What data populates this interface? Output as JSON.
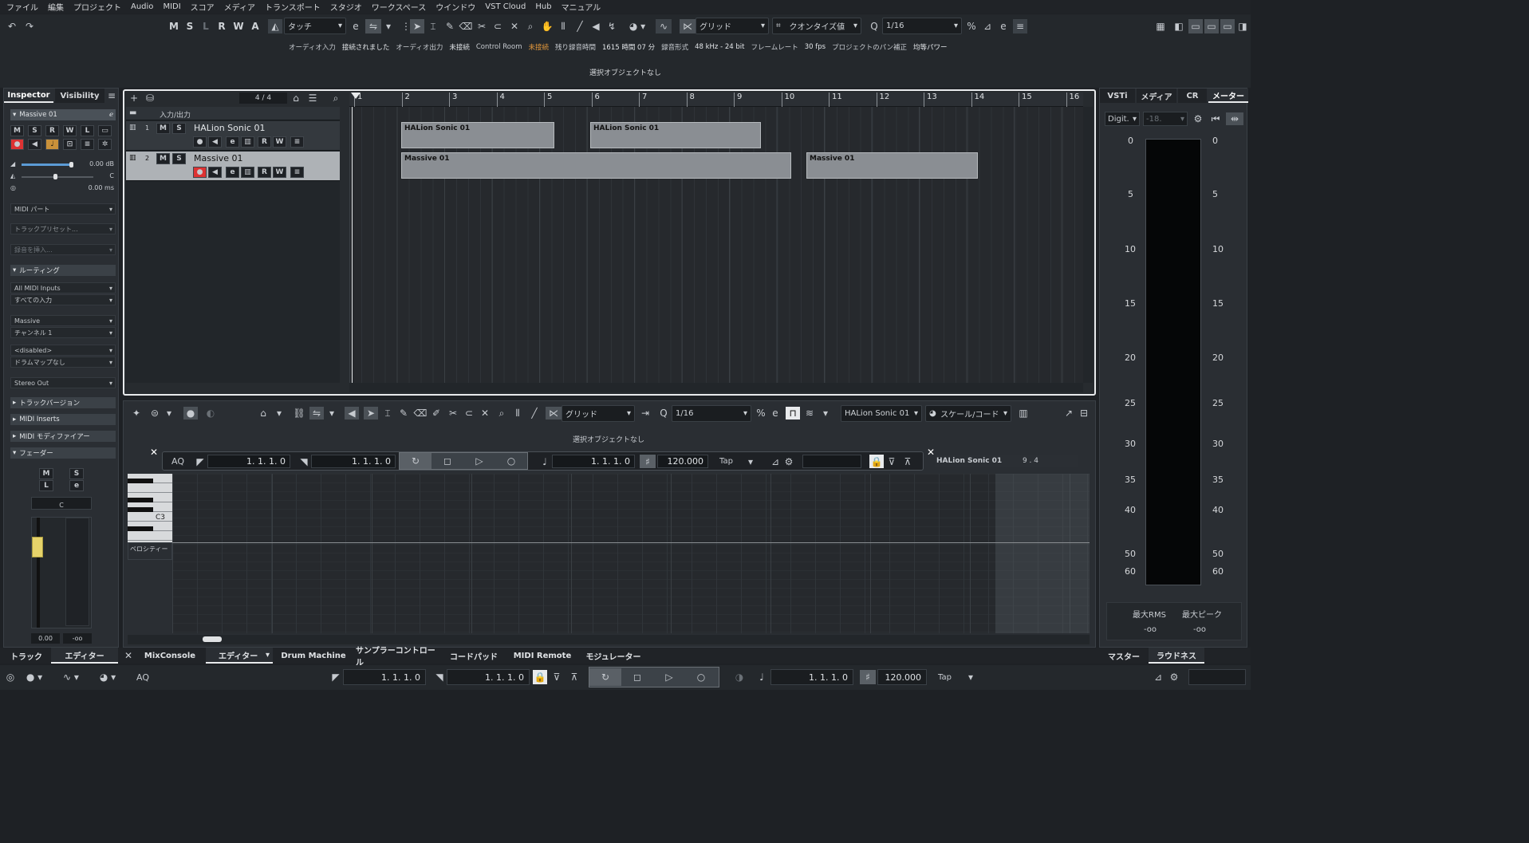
{
  "menu": [
    "ファイル",
    "編集",
    "プロジェクト",
    "Audio",
    "MIDI",
    "スコア",
    "メディア",
    "トランスポート",
    "スタジオ",
    "ワークスペース",
    "ウインドウ",
    "VST Cloud",
    "Hub",
    "マニュアル"
  ],
  "toolbar": {
    "m": "M",
    "s": "S",
    "l": "L",
    "r": "R",
    "w": "W",
    "a": "A",
    "automation_mode": "タッチ",
    "snap": "グリッド",
    "quantize_type": "クオンタイズ値",
    "quantize_value": "1/16"
  },
  "status": {
    "audio_in_label": "オーディオ入力",
    "audio_in": "接続されました",
    "audio_out_label": "オーディオ出力",
    "audio_out": "未接続",
    "cr_label": "Control Room",
    "cr": "未接続",
    "rec_time_label": "残り録音時間",
    "rec_time": "1615 時間 07 分",
    "rec_format_label": "録音形式",
    "rec_format": "48 kHz - 24 bit",
    "framerate_label": "フレームレート",
    "framerate": "30 fps",
    "pan_label": "プロジェクトのパン補正",
    "pan": "均等パワー"
  },
  "info_line": "選択オブジェクトなし",
  "inspector": {
    "tab_inspector": "Inspector",
    "tab_visibility": "Visibility",
    "track_name": "Massive 01",
    "volume": "0.00 dB",
    "pan": "C",
    "delay": "0.00 ms",
    "midi_part": "MIDI パート",
    "track_preset": "トラックプリセット...",
    "insert_audio": "録音を挿入...",
    "routing": "ルーティング",
    "midi_in": "All MIDI Inputs",
    "all_in": "すべての入力",
    "instrument": "Massive",
    "channel": "チャンネル 1",
    "disabled": "<disabled>",
    "drum_map": "ドラムマップなし",
    "out": "Stereo Out",
    "sec_version": "トラックバージョン",
    "sec_inserts": "MIDI Inserts",
    "sec_modifiers": "MIDI モディファイアー",
    "sec_fader": "フェーダー",
    "fader_m": "M",
    "fader_s": "S",
    "fader_l": "L",
    "fader_e": "e",
    "fader_pan": "C",
    "fader_val": "0.00",
    "fader_peak": "-oo"
  },
  "arranger": {
    "signature": "4 / 4",
    "io_label": "入力/出力",
    "ruler": [
      "1",
      "2",
      "3",
      "4",
      "5",
      "6",
      "7",
      "8",
      "9",
      "10",
      "11",
      "12",
      "13",
      "14",
      "15",
      "16"
    ],
    "tracks": [
      {
        "num": "1",
        "name": "HALion Sonic 01"
      },
      {
        "num": "2",
        "name": "Massive 01"
      }
    ],
    "parts": [
      {
        "label": "HALion Sonic 01"
      },
      {
        "label": "HALion Sonic 01"
      },
      {
        "label": "Massive 01"
      },
      {
        "label": "Massive 01"
      }
    ]
  },
  "editor": {
    "snap": "グリッド",
    "quantize": "1/16",
    "instrument": "HALion Sonic 01",
    "scale": "スケール/コード",
    "info_line": "選択オブジェクトなし",
    "note_label": "C3",
    "lane_label": "ベロシティー",
    "ruler_part": "HALion Sonic 01",
    "ruler_pos": "9 . 4",
    "aq": "AQ",
    "left_loc": "1. 1. 1.   0",
    "right_loc": "1. 1. 1.   0",
    "pos": "1. 1. 1.   0",
    "tempo": "120.000",
    "tap": "Tap"
  },
  "right": {
    "tabs": [
      "VSTi",
      "メディア",
      "CR",
      "メーター"
    ],
    "digit": "Digit.",
    "digit_val": "-18.",
    "scale": [
      "0",
      "5",
      "10",
      "15",
      "20",
      "25",
      "30",
      "35",
      "40",
      "50",
      "60"
    ],
    "max_rms_label": "最大RMS",
    "max_peak_label": "最大ピーク",
    "max_rms": "-oo",
    "max_peak": "-oo",
    "bottom_tabs": [
      "マスター",
      "ラウドネス"
    ]
  },
  "bottom_tabs": [
    "トラック",
    "エディター",
    "MixConsole",
    "エディター",
    "Drum Machine",
    "サンプラーコントロール",
    "コードパッド",
    "MIDI Remote",
    "モジュレーター"
  ],
  "transport": {
    "aq": "AQ",
    "left": "1. 1. 1.   0",
    "right": "1. 1. 1.   0",
    "pos": "1. 1. 1.   0",
    "tempo": "120.000",
    "tap": "Tap"
  }
}
